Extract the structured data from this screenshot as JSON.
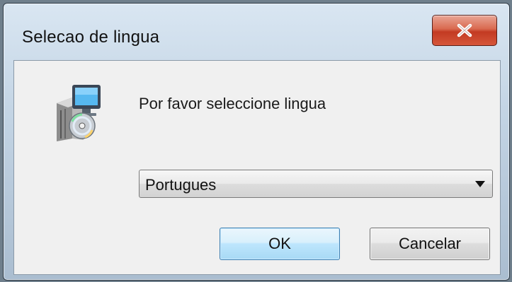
{
  "window": {
    "title": "Selecao de lingua",
    "close_icon": "close-x-icon"
  },
  "dialog": {
    "app_icon": "installer-computer-cd-icon",
    "prompt": "Por favor seleccione lingua",
    "language_select": {
      "selected": "Portugues"
    },
    "ok_label": "OK",
    "cancel_label": "Cancelar"
  },
  "colors": {
    "dialog_background": "#f0f0f0",
    "close_button_red": "#c33a22",
    "default_button_blue": "#bee6fd"
  }
}
